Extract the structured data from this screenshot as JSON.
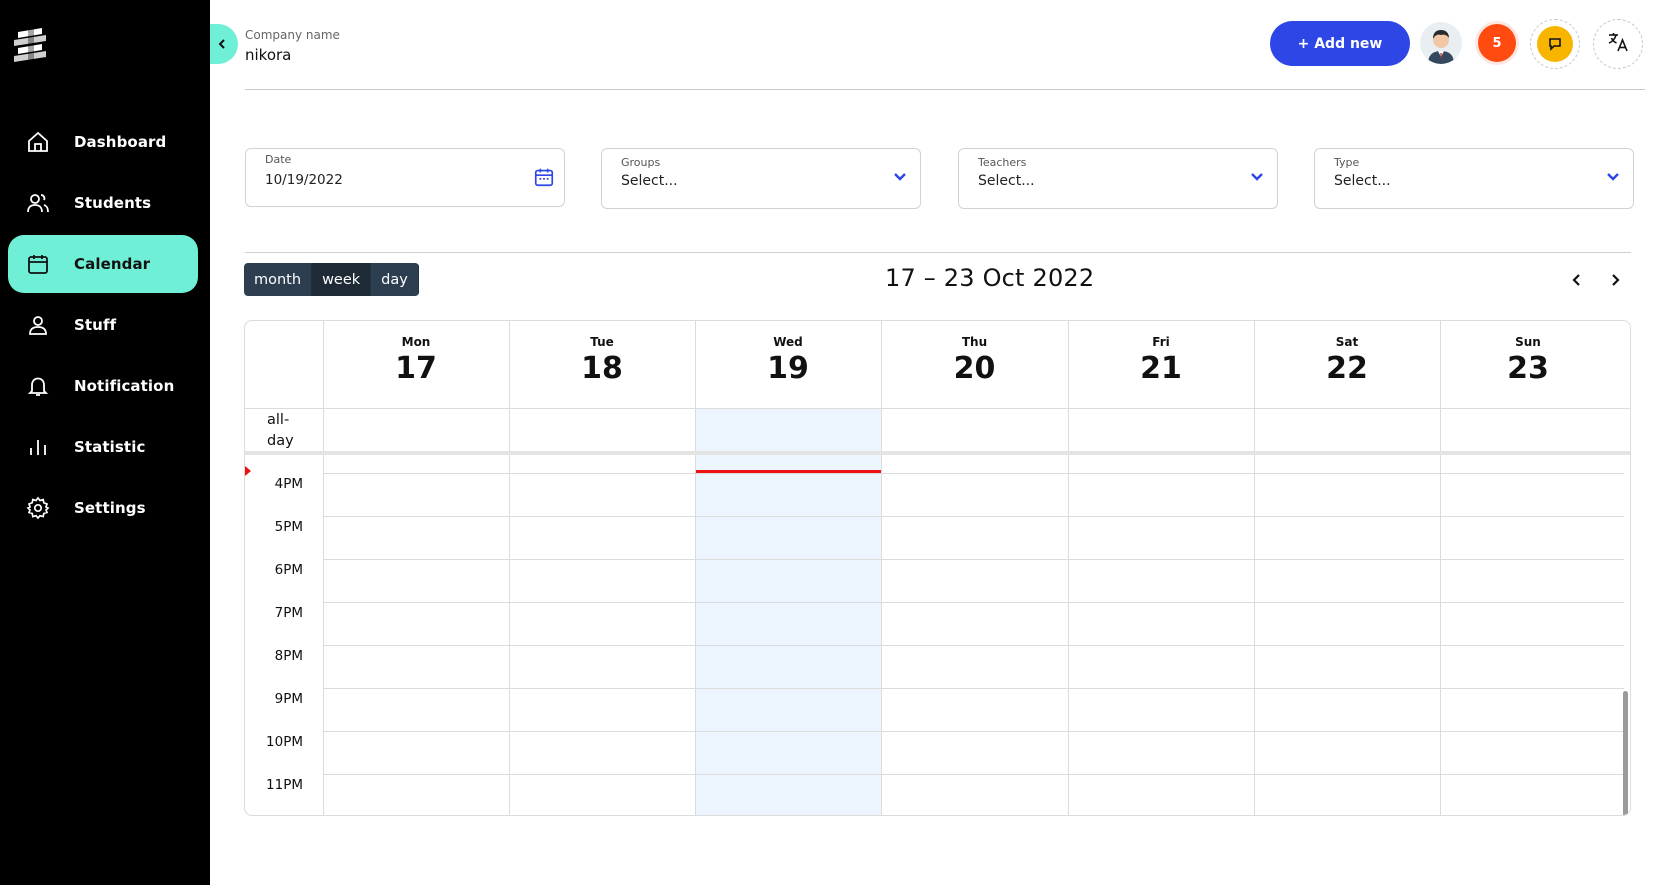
{
  "sidebar": {
    "items": [
      {
        "label": "Dashboard",
        "icon": "home-icon"
      },
      {
        "label": "Students",
        "icon": "users-icon"
      },
      {
        "label": "Calendar",
        "icon": "calendar-icon",
        "active": true
      },
      {
        "label": "Stuff",
        "icon": "user-icon"
      },
      {
        "label": "Notification",
        "icon": "bell-icon"
      },
      {
        "label": "Statistic",
        "icon": "bar-chart-icon"
      },
      {
        "label": "Settings",
        "icon": "gear-icon"
      }
    ]
  },
  "header": {
    "company_label": "Company name",
    "company_name": "nikora",
    "add_button": "+ Add new",
    "notification_count": "5"
  },
  "filters": {
    "date": {
      "label": "Date",
      "value": "10/19/2022"
    },
    "groups": {
      "label": "Groups",
      "placeholder": "Select..."
    },
    "teachers": {
      "label": "Teachers",
      "placeholder": "Select..."
    },
    "type": {
      "label": "Type",
      "placeholder": "Select..."
    }
  },
  "calendar": {
    "views": [
      "month",
      "week",
      "day"
    ],
    "active_view": "week",
    "range_title": "17 – 23 Oct 2022",
    "days": [
      {
        "name": "Mon",
        "num": "17"
      },
      {
        "name": "Tue",
        "num": "18"
      },
      {
        "name": "Wed",
        "num": "19",
        "today": true
      },
      {
        "name": "Thu",
        "num": "20"
      },
      {
        "name": "Fri",
        "num": "21"
      },
      {
        "name": "Sat",
        "num": "22"
      },
      {
        "name": "Sun",
        "num": "23"
      }
    ],
    "allday_label": "all-day",
    "time_slots": [
      "4PM",
      "5PM",
      "6PM",
      "7PM",
      "8PM",
      "9PM",
      "10PM",
      "11PM"
    ]
  },
  "colors": {
    "accent": "#6ff0d6",
    "primary": "#2d46e5",
    "sidebar_bg": "#000000",
    "today_bg": "#edf5ff",
    "now_indicator": "#ee1111",
    "badge": "#ff4a10",
    "chat": "#f7b500"
  }
}
